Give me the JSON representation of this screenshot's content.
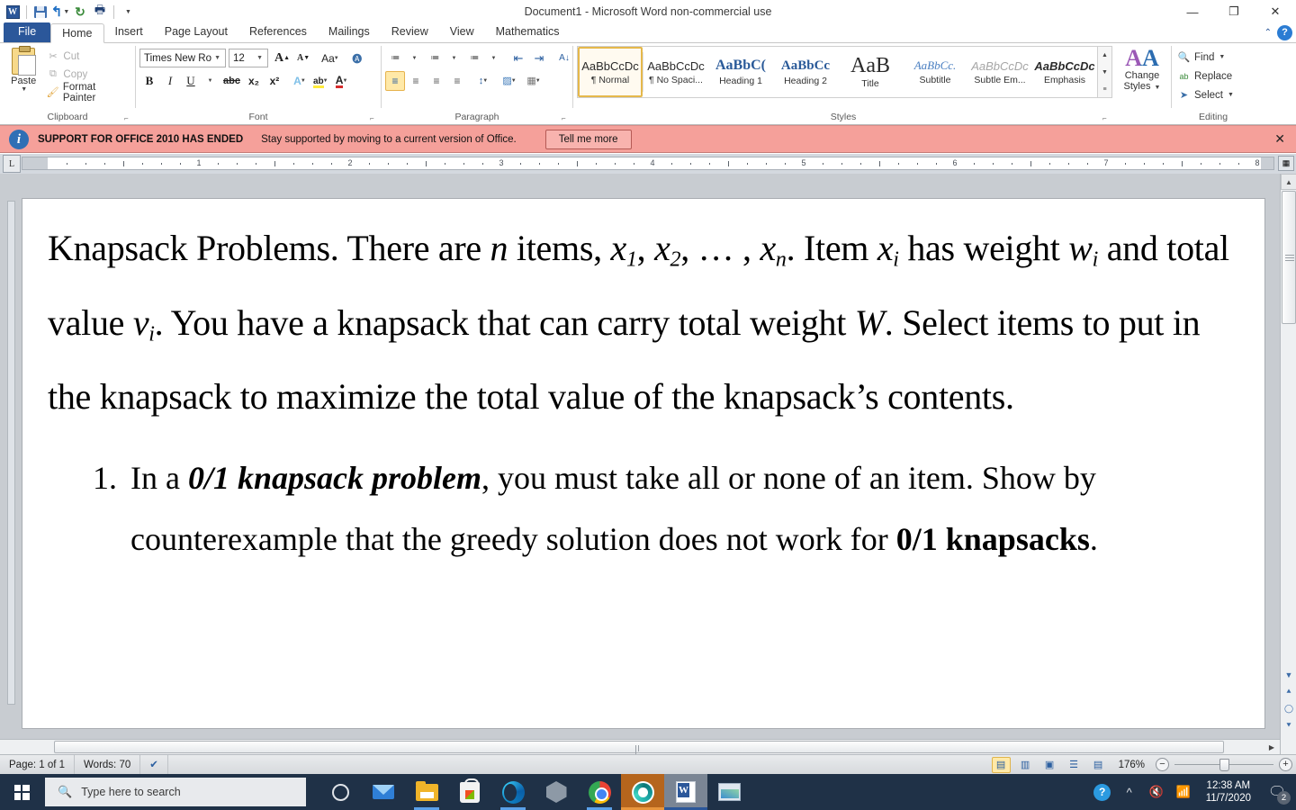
{
  "window": {
    "title": "Document1  -  Microsoft Word non-commercial use",
    "minimize": "—",
    "restore": "❐",
    "close": "✕"
  },
  "quick_access": {
    "app_logo": "W",
    "save_tip": "Save",
    "undo_tip": "Undo",
    "redo_tip": "Repeat",
    "print_preview_tip": "Print Preview and Print",
    "customize_tip": "Customize Quick Access Toolbar"
  },
  "tabs": [
    {
      "label": "File",
      "active": false,
      "kind": "file"
    },
    {
      "label": "Home",
      "active": true,
      "kind": "normal"
    },
    {
      "label": "Insert",
      "active": false,
      "kind": "normal"
    },
    {
      "label": "Page Layout",
      "active": false,
      "kind": "normal"
    },
    {
      "label": "References",
      "active": false,
      "kind": "normal"
    },
    {
      "label": "Mailings",
      "active": false,
      "kind": "normal"
    },
    {
      "label": "Review",
      "active": false,
      "kind": "normal"
    },
    {
      "label": "View",
      "active": false,
      "kind": "normal"
    },
    {
      "label": "Mathematics",
      "active": false,
      "kind": "normal"
    }
  ],
  "ribbon": {
    "clipboard": {
      "group_label": "Clipboard",
      "paste_label": "Paste",
      "cut_label": "Cut",
      "copy_label": "Copy",
      "format_painter_label": "Format Painter"
    },
    "font": {
      "group_label": "Font",
      "font_name": "Times New Rom",
      "font_size": "12",
      "grow_font": "A",
      "shrink_font": "A",
      "change_case": "Aa",
      "clear_formatting": "A",
      "bold": "B",
      "italic": "I",
      "underline": "U",
      "strikethrough": "abc",
      "subscript": "x₂",
      "superscript": "x²",
      "text_effects": "A",
      "highlight": "ab",
      "font_color": "A"
    },
    "paragraph": {
      "group_label": "Paragraph",
      "bullets": "≔",
      "numbering": "≔",
      "multilevel": "≔",
      "decrease_indent": "⇤",
      "increase_indent": "⇥",
      "sort": "A\\nZ",
      "show_marks": "¶",
      "align_left": "≡",
      "align_center": "≡",
      "align_right": "≡",
      "justify": "≡",
      "line_spacing": "↕",
      "shading": "▨",
      "borders": "▦"
    },
    "styles": {
      "group_label": "Styles",
      "items": [
        {
          "preview": "AaBbCcDc",
          "name": "¶ Normal",
          "selected": true
        },
        {
          "preview": "AaBbCcDc",
          "name": "¶ No Spaci...",
          "selected": false
        },
        {
          "preview": "AaBbC(",
          "name": "Heading 1",
          "selected": false
        },
        {
          "preview": "AaBbCc",
          "name": "Heading 2",
          "selected": false
        },
        {
          "preview": "AaB",
          "name": "Title",
          "selected": false
        },
        {
          "preview": "AaBbCc.",
          "name": "Subtitle",
          "selected": false
        },
        {
          "preview": "AaBbCcDc",
          "name": "Subtle Em...",
          "selected": false
        },
        {
          "preview": "AaBbCcDc",
          "name": "Emphasis",
          "selected": false
        }
      ]
    },
    "change_styles": {
      "label_line1": "Change",
      "label_line2": "Styles"
    },
    "editing": {
      "group_label": "Editing",
      "find_label": "Find",
      "replace_label": "Replace",
      "select_label": "Select"
    }
  },
  "notification": {
    "headline": "SUPPORT FOR OFFICE 2010 HAS ENDED",
    "message": "Stay supported by moving to a current version of Office.",
    "button": "Tell me more",
    "close": "✕",
    "info_glyph": "i",
    "background_color": "#f5a09a"
  },
  "ruler": {
    "tab_stop_marker": "L",
    "numbers": [
      "1",
      "2",
      "3",
      "4",
      "5",
      "6",
      "7",
      "8"
    ]
  },
  "document": {
    "paragraph1": {
      "t1": "Knapsack Problems",
      "t2": ".   There are ",
      "v_n": "n",
      "t3": " items, ",
      "v_x1": "x",
      "s_1": "1",
      "t4": ", ",
      "v_x2": "x",
      "s_2": "2",
      "t5": ", … , ",
      "v_xn": "x",
      "s_n": "n",
      "t6": ".   Item ",
      "v_xi": "x",
      "s_i": "i",
      "t7": " has weight ",
      "v_w": "w",
      "s_wi": "i",
      "t8": " and total value ",
      "v_v": "v",
      "s_vi": "i",
      "t9": ". You have a knapsack that can carry total weight ",
      "v_W": "W",
      "t10": ". Select items to put in the knapsack to maximize the total value of the knapsack’s contents."
    },
    "list": [
      {
        "number": "1.",
        "pre": "In a ",
        "bold_italic": "0/1 knapsack problem",
        "mid": ", you must take all or none of an item. Show by counterexample that the greedy solution does not work for ",
        "bold": "0/1 knapsacks",
        "post": "."
      }
    ]
  },
  "status_bar": {
    "page": "Page: 1 of 1",
    "words": "Words: 70",
    "proofing_tip": "Proofing errors",
    "zoom_percent": "176%",
    "zoom_out": "−",
    "zoom_in": "+",
    "views": [
      {
        "name": "print-layout",
        "glyph": "▤",
        "active": true
      },
      {
        "name": "full-screen-reading",
        "glyph": "▥",
        "active": false
      },
      {
        "name": "web-layout",
        "glyph": "▣",
        "active": false
      },
      {
        "name": "outline",
        "glyph": "☰",
        "active": false
      },
      {
        "name": "draft",
        "glyph": "▤",
        "active": false
      }
    ]
  },
  "taskbar": {
    "search_placeholder": "Type here to search",
    "start_tip": "Start",
    "cortana_tip": "Cortana",
    "items": [
      {
        "name": "cortana",
        "running": false
      },
      {
        "name": "mail",
        "running": false
      },
      {
        "name": "file-explorer",
        "running": true
      },
      {
        "name": "microsoft-store",
        "running": false
      },
      {
        "name": "microsoft-edge",
        "running": true
      },
      {
        "name": "virtualbox",
        "running": false
      },
      {
        "name": "google-chrome",
        "running": true
      },
      {
        "name": "teal-app",
        "running": true
      },
      {
        "name": "microsoft-word",
        "running": true
      },
      {
        "name": "photos",
        "running": false
      }
    ],
    "tray": {
      "help_glyph": "?",
      "chevron": "^",
      "volume_muted": true,
      "network": "wifi",
      "time": "12:38 AM",
      "date": "11/7/2020",
      "notification_count": "2"
    }
  }
}
